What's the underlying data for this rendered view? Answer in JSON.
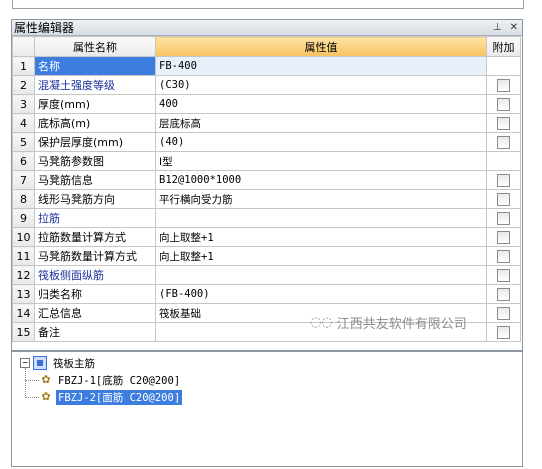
{
  "window": {
    "title": "属性编辑器",
    "pin_glyph": "⊥",
    "close_glyph": "✕"
  },
  "table": {
    "headers": {
      "num": "",
      "name": "属性名称",
      "value": "属性值",
      "add": "附加"
    },
    "rows": [
      {
        "num": "1",
        "name": "名称",
        "value": "FB-400",
        "checkbox": false,
        "style": "selected"
      },
      {
        "num": "2",
        "name": "混凝土强度等级",
        "value": "(C30)",
        "checkbox": true,
        "style": "blue"
      },
      {
        "num": "3",
        "name": "厚度(mm)",
        "value": "400",
        "checkbox": true,
        "style": "normal"
      },
      {
        "num": "4",
        "name": "底标高(m)",
        "value": "层底标高",
        "checkbox": true,
        "style": "normal"
      },
      {
        "num": "5",
        "name": "保护层厚度(mm)",
        "value": "(40)",
        "checkbox": true,
        "style": "normal"
      },
      {
        "num": "6",
        "name": "马凳筋参数图",
        "value": "Ⅰ型",
        "checkbox": false,
        "style": "normal"
      },
      {
        "num": "7",
        "name": "马凳筋信息",
        "value": "B12@1000*1000",
        "checkbox": true,
        "style": "normal"
      },
      {
        "num": "8",
        "name": "线形马凳筋方向",
        "value": "平行横向受力筋",
        "checkbox": true,
        "style": "normal"
      },
      {
        "num": "9",
        "name": "拉筋",
        "value": "",
        "checkbox": true,
        "style": "blue"
      },
      {
        "num": "10",
        "name": "拉筋数量计算方式",
        "value": "向上取整+1",
        "checkbox": true,
        "style": "normal"
      },
      {
        "num": "11",
        "name": "马凳筋数量计算方式",
        "value": "向上取整+1",
        "checkbox": true,
        "style": "normal"
      },
      {
        "num": "12",
        "name": "筏板侧面纵筋",
        "value": "",
        "checkbox": true,
        "style": "blue"
      },
      {
        "num": "13",
        "name": "归类名称",
        "value": "(FB-400)",
        "checkbox": true,
        "style": "normal"
      },
      {
        "num": "14",
        "name": "汇总信息",
        "value": "筏板基础",
        "checkbox": true,
        "style": "normal"
      },
      {
        "num": "15",
        "name": "备注",
        "value": "",
        "checkbox": true,
        "style": "normal"
      }
    ]
  },
  "tree": {
    "root": {
      "expander": "−",
      "label": "筏板主筋"
    },
    "children": [
      {
        "label": "FBZJ-1[底筋 C20@200]",
        "selected": false
      },
      {
        "label": "FBZJ-2[面筋 C20@200]",
        "selected": true
      }
    ]
  },
  "watermark": {
    "text": "江西共友软件有限公司",
    "icon": "wechat-icon"
  }
}
